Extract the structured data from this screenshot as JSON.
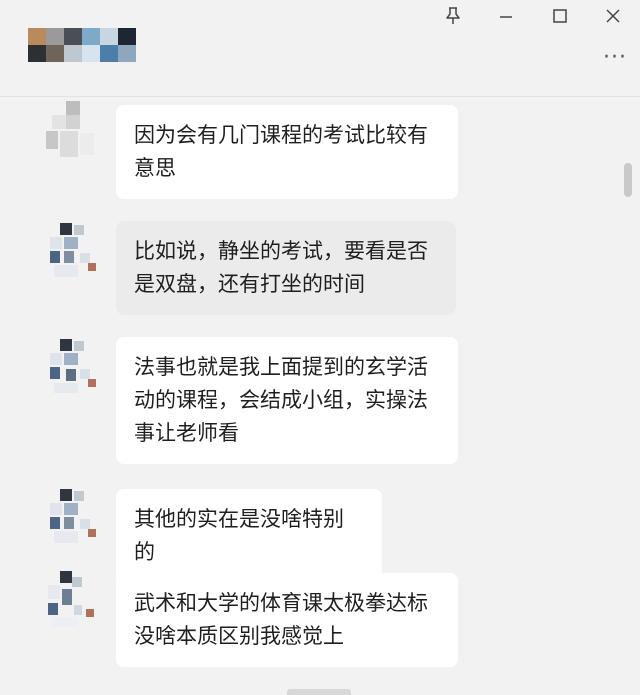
{
  "window": {
    "pin_icon": "pin-icon",
    "minimize_icon": "minimize-icon",
    "maximize_icon": "maximize-icon",
    "close_icon": "close-icon",
    "more_label": "···"
  },
  "messages": [
    {
      "text": "因为会有几门课程的考试比较有意思"
    },
    {
      "text": "比如说，静坐的考试，要看是否是双盘，还有打坐的时间"
    },
    {
      "text": "法事也就是我上面提到的玄学活动的课程，会结成小组，实操法事让老师看"
    },
    {
      "text": "其他的实在是没啥特别的"
    },
    {
      "text": "武术和大学的体育课太极拳达标没啥本质区别我感觉上"
    }
  ],
  "colors": {
    "background": "#f2f2f2",
    "bubble": "#ffffff",
    "bubble_selected": "#ebebeb"
  }
}
